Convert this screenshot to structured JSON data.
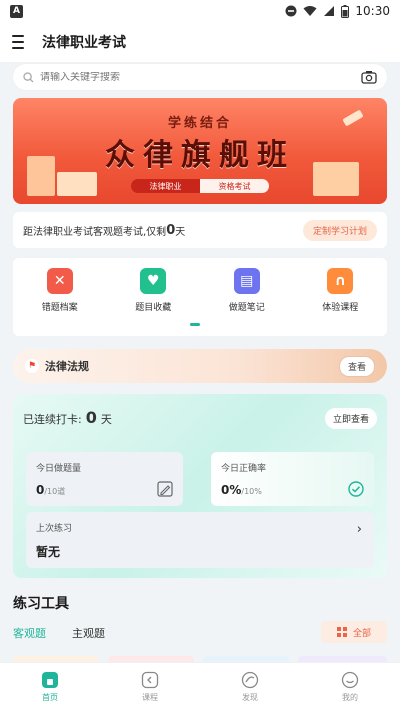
{
  "status_bar": {
    "app_badge": "A",
    "time": "10:30"
  },
  "app_bar": {
    "title": "法律职业考试"
  },
  "search": {
    "placeholder": "请输入关键字搜索"
  },
  "banner": {
    "subtitle": "学练结合",
    "title": "众律旗舰班",
    "tag_left": "法律职业",
    "tag_right": "资格考试"
  },
  "countdown": {
    "prefix": "距法律职业考试客观题考试,仅剩",
    "days": "0",
    "suffix": "天",
    "button": "定制学习计划"
  },
  "quick_menu": [
    {
      "label": "错题档案",
      "icon": "error-archive-icon",
      "color": "#f25a4a"
    },
    {
      "label": "题目收藏",
      "icon": "favorite-heart-icon",
      "color": "#22c08f"
    },
    {
      "label": "做题笔记",
      "icon": "notes-book-icon",
      "color": "#6e73f0"
    },
    {
      "label": "体验课程",
      "icon": "headphone-course-icon",
      "color": "#ff8c3a"
    }
  ],
  "law_bar": {
    "label": "法律法规",
    "button": "查看"
  },
  "checkin": {
    "label": "已连续打卡:",
    "days": "0",
    "unit": "天",
    "button": "立即查看",
    "today_count": {
      "title": "今日做题量",
      "value": "0",
      "total": "/10道"
    },
    "today_accuracy": {
      "title": "今日正确率",
      "value": "0%",
      "total": "/10%"
    },
    "last_practice": {
      "title": "上次练习",
      "value": "暂无"
    }
  },
  "tools": {
    "title": "练习工具",
    "tabs": [
      "客观题",
      "主观题"
    ],
    "all_button": "全部"
  },
  "bottom_nav": [
    {
      "label": "首页",
      "active": true
    },
    {
      "label": "课程",
      "active": false
    },
    {
      "label": "发现",
      "active": false
    },
    {
      "label": "我的",
      "active": false
    }
  ],
  "colors": {
    "accent": "#1fb59a",
    "banner": "#f25a3c",
    "orange": "#e8664a"
  }
}
